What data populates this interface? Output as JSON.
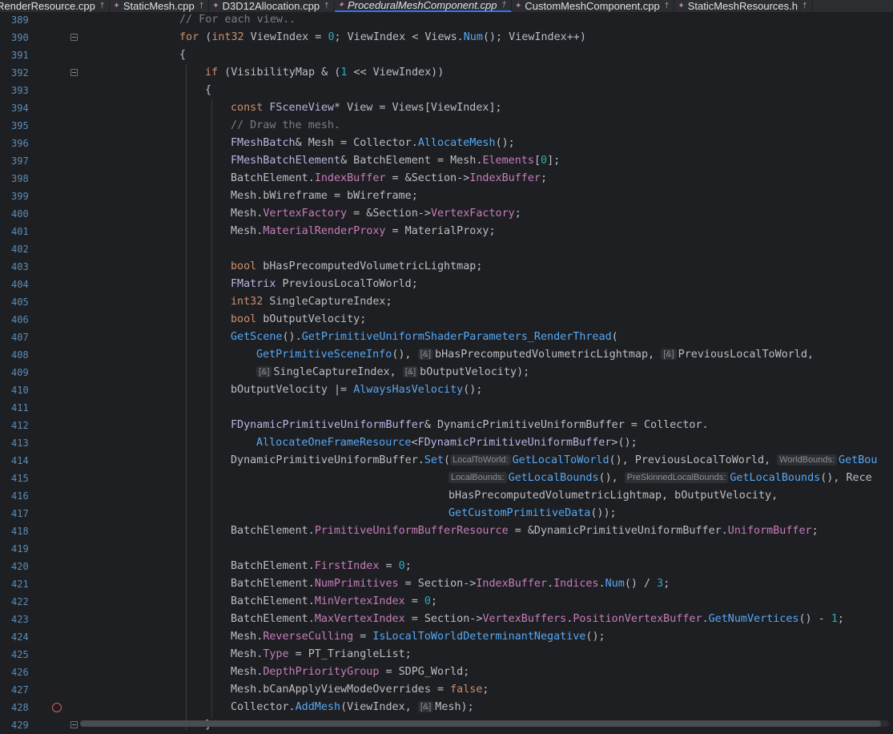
{
  "tabs": [
    {
      "label": "RenderResource.cpp"
    },
    {
      "label": "StaticMesh.cpp"
    },
    {
      "label": "D3D12Allocation.cpp"
    },
    {
      "label": "ProceduralMeshComponent.cpp",
      "active": true
    },
    {
      "label": "CustomMeshComponent.cpp"
    },
    {
      "label": "StaticMeshResources.h"
    }
  ],
  "tab_icons": {
    "file": "cpp-file-icon",
    "pin": "pin-icon"
  },
  "lines": [
    {
      "n": "389",
      "indent": 4,
      "tokens": [
        [
          "cm",
          "// For each view.."
        ]
      ]
    },
    {
      "n": "390",
      "indent": 4,
      "fold": true,
      "tokens": [
        [
          "kw",
          "for"
        ],
        [
          "p",
          " ("
        ],
        [
          "kw",
          "int32"
        ],
        [
          "p",
          " ViewIndex = "
        ],
        [
          "nu",
          "0"
        ],
        [
          "p",
          "; ViewIndex < Views."
        ],
        [
          "fn",
          "Num"
        ],
        [
          "p",
          "(); ViewIndex++)"
        ]
      ]
    },
    {
      "n": "391",
      "indent": 4,
      "tokens": [
        [
          "p",
          "{"
        ]
      ]
    },
    {
      "n": "392",
      "indent": 5,
      "fold": true,
      "tokens": [
        [
          "kw",
          "if"
        ],
        [
          "p",
          " (VisibilityMap & ("
        ],
        [
          "nu",
          "1"
        ],
        [
          "p",
          " << ViewIndex))"
        ]
      ]
    },
    {
      "n": "393",
      "indent": 5,
      "tokens": [
        [
          "p",
          "{"
        ]
      ]
    },
    {
      "n": "394",
      "indent": 6,
      "tokens": [
        [
          "kw",
          "const"
        ],
        [
          "p",
          " "
        ],
        [
          "ty",
          "FSceneView"
        ],
        [
          "p",
          "* View = Views[ViewIndex];"
        ]
      ]
    },
    {
      "n": "395",
      "indent": 6,
      "tokens": [
        [
          "cm",
          "// Draw the mesh."
        ]
      ]
    },
    {
      "n": "396",
      "indent": 6,
      "tokens": [
        [
          "ty",
          "FMeshBatch"
        ],
        [
          "p",
          "& Mesh = Collector."
        ],
        [
          "fn",
          "AllocateMesh"
        ],
        [
          "p",
          "();"
        ]
      ]
    },
    {
      "n": "397",
      "indent": 6,
      "tokens": [
        [
          "ty",
          "FMeshBatchElement"
        ],
        [
          "p",
          "& BatchElement = Mesh."
        ],
        [
          "me",
          "Elements"
        ],
        [
          "p",
          "["
        ],
        [
          "nu",
          "0"
        ],
        [
          "p",
          "];"
        ]
      ]
    },
    {
      "n": "398",
      "indent": 6,
      "tokens": [
        [
          "p",
          "BatchElement."
        ],
        [
          "me",
          "IndexBuffer"
        ],
        [
          "p",
          " = &Section->"
        ],
        [
          "me",
          "IndexBuffer"
        ],
        [
          "p",
          ";"
        ]
      ]
    },
    {
      "n": "399",
      "indent": 6,
      "tokens": [
        [
          "p",
          "Mesh.bWireframe = bWireframe;"
        ]
      ]
    },
    {
      "n": "400",
      "indent": 6,
      "tokens": [
        [
          "p",
          "Mesh."
        ],
        [
          "me",
          "VertexFactory"
        ],
        [
          "p",
          " = &Section->"
        ],
        [
          "me",
          "VertexFactory"
        ],
        [
          "p",
          ";"
        ]
      ]
    },
    {
      "n": "401",
      "indent": 6,
      "tokens": [
        [
          "p",
          "Mesh."
        ],
        [
          "me",
          "MaterialRenderProxy"
        ],
        [
          "p",
          " = MaterialProxy;"
        ]
      ]
    },
    {
      "n": "402",
      "indent": 6,
      "tokens": []
    },
    {
      "n": "403",
      "indent": 6,
      "tokens": [
        [
          "kw",
          "bool"
        ],
        [
          "p",
          " bHasPrecomputedVolumetricLightmap;"
        ]
      ]
    },
    {
      "n": "404",
      "indent": 6,
      "tokens": [
        [
          "ty",
          "FMatrix"
        ],
        [
          "p",
          " PreviousLocalToWorld;"
        ]
      ]
    },
    {
      "n": "405",
      "indent": 6,
      "tokens": [
        [
          "kw",
          "int32"
        ],
        [
          "p",
          " SingleCaptureIndex;"
        ]
      ]
    },
    {
      "n": "406",
      "indent": 6,
      "tokens": [
        [
          "kw",
          "bool"
        ],
        [
          "p",
          " bOutputVelocity;"
        ]
      ]
    },
    {
      "n": "407",
      "indent": 6,
      "tokens": [
        [
          "fn",
          "GetScene"
        ],
        [
          "p",
          "()."
        ],
        [
          "fn",
          "GetPrimitiveUniformShaderParameters_RenderThread"
        ],
        [
          "p",
          "("
        ]
      ]
    },
    {
      "n": "408",
      "indent": 7,
      "tokens": [
        [
          "fn",
          "GetPrimitiveSceneInfo"
        ],
        [
          "p",
          "(), "
        ],
        [
          "h",
          "[&]"
        ],
        [
          "p",
          "bHasPrecomputedVolumetricLightmap, "
        ],
        [
          "h",
          "[&]"
        ],
        [
          "p",
          "PreviousLocalToWorld,"
        ]
      ]
    },
    {
      "n": "409",
      "indent": 7,
      "tokens": [
        [
          "h",
          "[&]"
        ],
        [
          "p",
          "SingleCaptureIndex, "
        ],
        [
          "h",
          "[&]"
        ],
        [
          "p",
          "bOutputVelocity);"
        ]
      ]
    },
    {
      "n": "410",
      "indent": 6,
      "tokens": [
        [
          "p",
          "bOutputVelocity |= "
        ],
        [
          "fn",
          "AlwaysHasVelocity"
        ],
        [
          "p",
          "();"
        ]
      ]
    },
    {
      "n": "411",
      "indent": 6,
      "tokens": []
    },
    {
      "n": "412",
      "indent": 6,
      "tokens": [
        [
          "ty",
          "FDynamicPrimitiveUniformBuffer"
        ],
        [
          "p",
          "& DynamicPrimitiveUniformBuffer = Collector."
        ]
      ]
    },
    {
      "n": "413",
      "indent": 7,
      "tokens": [
        [
          "fn",
          "AllocateOneFrameResource"
        ],
        [
          "p",
          "<"
        ],
        [
          "ty",
          "FDynamicPrimitiveUniformBuffer"
        ],
        [
          "p",
          ">();"
        ]
      ]
    },
    {
      "n": "414",
      "indent": 6,
      "tokens": [
        [
          "p",
          "DynamicPrimitiveUniformBuffer."
        ],
        [
          "fn",
          "Set"
        ],
        [
          "p",
          "("
        ],
        [
          "h",
          "LocalToWorld:"
        ],
        [
          "fn",
          "GetLocalToWorld"
        ],
        [
          "p",
          "(), PreviousLocalToWorld, "
        ],
        [
          "h",
          "WorldBounds:"
        ],
        [
          "fn",
          "GetBou"
        ]
      ]
    },
    {
      "n": "415",
      "indent": 6,
      "pad": 34,
      "tokens": [
        [
          "h",
          "LocalBounds:"
        ],
        [
          "fn",
          "GetLocalBounds"
        ],
        [
          "p",
          "(), "
        ],
        [
          "h",
          "PreSkinnedLocalBounds:"
        ],
        [
          "fn",
          "GetLocalBounds"
        ],
        [
          "p",
          "(), Rece"
        ]
      ]
    },
    {
      "n": "416",
      "indent": 6,
      "pad": 34,
      "tokens": [
        [
          "p",
          "bHasPrecomputedVolumetricLightmap, bOutputVelocity,"
        ]
      ]
    },
    {
      "n": "417",
      "indent": 6,
      "pad": 34,
      "tokens": [
        [
          "fn",
          "GetCustomPrimitiveData"
        ],
        [
          "p",
          "());"
        ]
      ]
    },
    {
      "n": "418",
      "indent": 6,
      "tokens": [
        [
          "p",
          "BatchElement."
        ],
        [
          "me",
          "PrimitiveUniformBufferResource"
        ],
        [
          "p",
          " = &DynamicPrimitiveUniformBuffer."
        ],
        [
          "me",
          "UniformBuffer"
        ],
        [
          "p",
          ";"
        ]
      ]
    },
    {
      "n": "419",
      "indent": 6,
      "tokens": []
    },
    {
      "n": "420",
      "indent": 6,
      "tokens": [
        [
          "p",
          "BatchElement."
        ],
        [
          "me",
          "FirstIndex"
        ],
        [
          "p",
          " = "
        ],
        [
          "nu",
          "0"
        ],
        [
          "p",
          ";"
        ]
      ]
    },
    {
      "n": "421",
      "indent": 6,
      "tokens": [
        [
          "p",
          "BatchElement."
        ],
        [
          "me",
          "NumPrimitives"
        ],
        [
          "p",
          " = Section->"
        ],
        [
          "me",
          "IndexBuffer"
        ],
        [
          "p",
          "."
        ],
        [
          "me",
          "Indices"
        ],
        [
          "p",
          "."
        ],
        [
          "fn",
          "Num"
        ],
        [
          "p",
          "() / "
        ],
        [
          "nu",
          "3"
        ],
        [
          "p",
          ";"
        ]
      ]
    },
    {
      "n": "422",
      "indent": 6,
      "tokens": [
        [
          "p",
          "BatchElement."
        ],
        [
          "me",
          "MinVertexIndex"
        ],
        [
          "p",
          " = "
        ],
        [
          "nu",
          "0"
        ],
        [
          "p",
          ";"
        ]
      ]
    },
    {
      "n": "423",
      "indent": 6,
      "tokens": [
        [
          "p",
          "BatchElement."
        ],
        [
          "me",
          "MaxVertexIndex"
        ],
        [
          "p",
          " = Section->"
        ],
        [
          "me",
          "VertexBuffers"
        ],
        [
          "p",
          "."
        ],
        [
          "me",
          "PositionVertexBuffer"
        ],
        [
          "p",
          "."
        ],
        [
          "fn",
          "GetNumVertices"
        ],
        [
          "p",
          "() - "
        ],
        [
          "nu",
          "1"
        ],
        [
          "p",
          ";"
        ]
      ]
    },
    {
      "n": "424",
      "indent": 6,
      "tokens": [
        [
          "p",
          "Mesh."
        ],
        [
          "me",
          "ReverseCulling"
        ],
        [
          "p",
          " = "
        ],
        [
          "fn",
          "IsLocalToWorldDeterminantNegative"
        ],
        [
          "p",
          "();"
        ]
      ]
    },
    {
      "n": "425",
      "indent": 6,
      "tokens": [
        [
          "p",
          "Mesh."
        ],
        [
          "me",
          "Type"
        ],
        [
          "p",
          " = PT_TriangleList;"
        ]
      ]
    },
    {
      "n": "426",
      "indent": 6,
      "tokens": [
        [
          "p",
          "Mesh."
        ],
        [
          "me",
          "DepthPriorityGroup"
        ],
        [
          "p",
          " = SDPG_World;"
        ]
      ]
    },
    {
      "n": "427",
      "indent": 6,
      "tokens": [
        [
          "p",
          "Mesh.bCanApplyViewModeOverrides = "
        ],
        [
          "kw",
          "false"
        ],
        [
          "p",
          ";"
        ]
      ]
    },
    {
      "n": "428",
      "indent": 6,
      "breakpoint": true,
      "tokens": [
        [
          "p",
          "Collector."
        ],
        [
          "fn",
          "AddMesh"
        ],
        [
          "p",
          "(ViewIndex, "
        ],
        [
          "h",
          "[&]"
        ],
        [
          "p",
          "Mesh);"
        ]
      ]
    },
    {
      "n": "429",
      "indent": 5,
      "fold": true,
      "tokens": [
        [
          "p",
          "}"
        ]
      ]
    }
  ],
  "icons": {
    "fold": "fold-marker-icon",
    "breakpoint": "breakpoint-icon"
  }
}
